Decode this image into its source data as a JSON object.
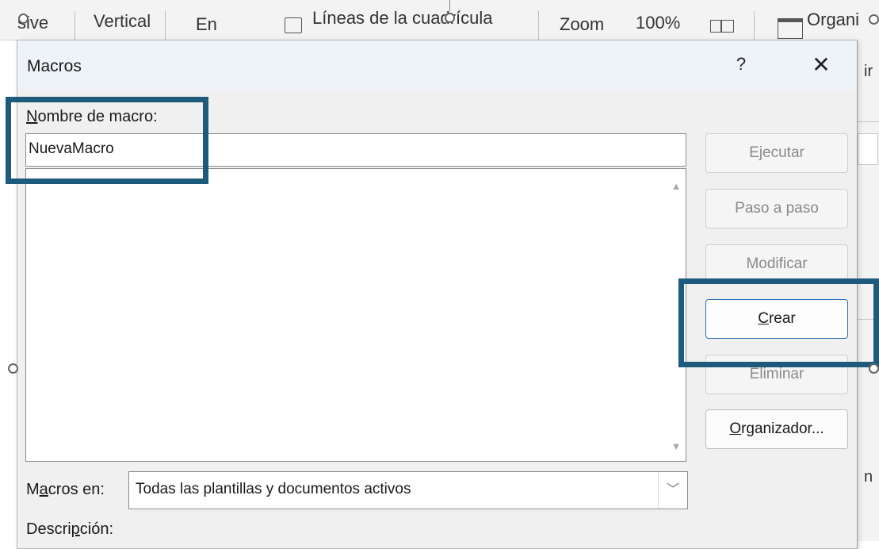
{
  "ribbon": {
    "items": [
      {
        "label": "sive"
      },
      {
        "label": "Vertical"
      },
      {
        "label": "En"
      },
      {
        "label": "Líneas de la cuadrícula"
      },
      {
        "label": "Zoom"
      },
      {
        "label": "100%"
      },
      {
        "label": "Organi"
      }
    ],
    "right_strip": {
      "top_text": "ir",
      "bottom_text": "n"
    }
  },
  "dialog": {
    "title": "Macros",
    "help_label": "?",
    "close_label": "✕",
    "macro_name_label_accel": "N",
    "macro_name_label_rest": "ombre de macro:",
    "macro_name_value": "NuevaMacro",
    "macro_list_items": [],
    "buttons": {
      "run": "Ejecutar",
      "step": "Paso a paso",
      "edit": "Modificar",
      "create_accel": "C",
      "create_rest": "rear",
      "delete": "Eliminar",
      "organizer_accel": "O",
      "organizer_rest": "rganizador..."
    },
    "macros_in_label_pre": "M",
    "macros_in_label_accel": "a",
    "macros_in_label_post": "cros en:",
    "macros_in_value": "Todas las plantillas y documentos activos",
    "description_label_pre": "Descri",
    "description_label_accel": "p",
    "description_label_post": "ción:"
  },
  "colors": {
    "highlight": "#1e5a7c",
    "default_button_border": "#2a6fb3",
    "dialog_bg": "#f0f0f0",
    "titlebar_bg": "#eef3f9"
  },
  "icons": {
    "help": "question-mark-icon",
    "close": "close-icon",
    "dropdown": "chevron-down-icon",
    "scroll_up": "triangle-up-icon",
    "scroll_down": "triangle-down-icon"
  }
}
